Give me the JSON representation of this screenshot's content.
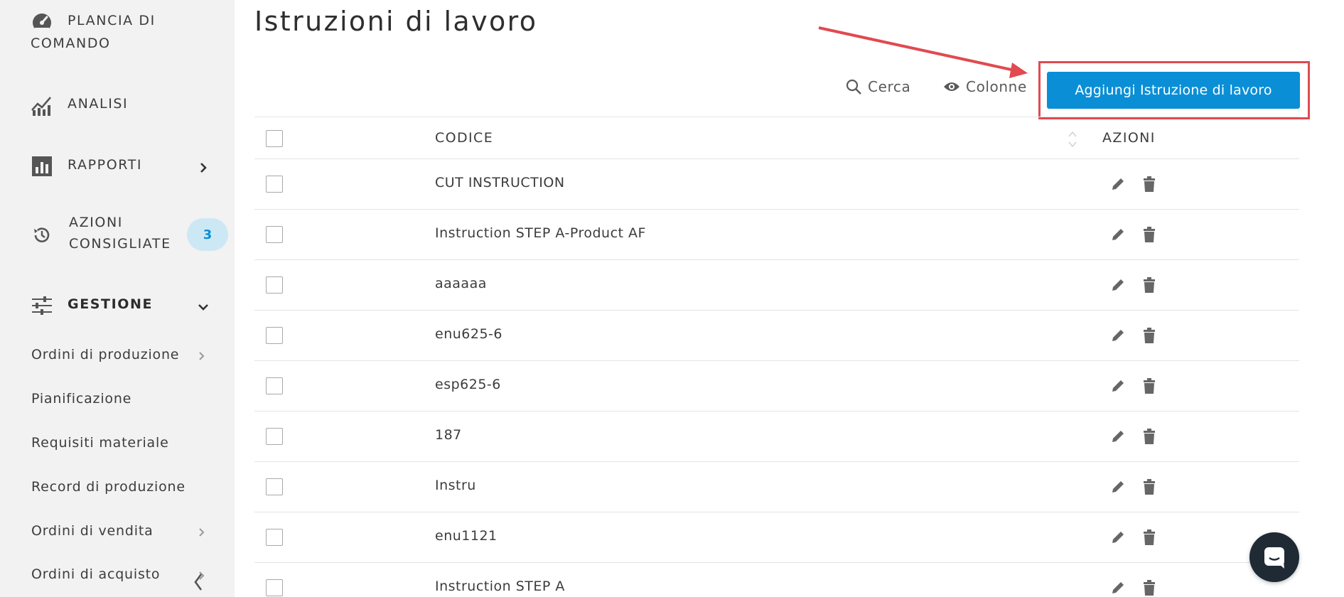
{
  "colors": {
    "accent": "#0a8fd6",
    "sidebar_bg": "#f2f2f2",
    "badge_bg": "#cde8f5",
    "highlight": "#e04a50",
    "chat_bg": "#1f2a35"
  },
  "sidebar": {
    "dashboard": {
      "label_line1": "PLANCIA DI",
      "label_line2": "COMANDO",
      "icon": "speedometer-icon"
    },
    "analytics": {
      "label": "ANALISI",
      "icon": "analytics-chart-icon"
    },
    "reports": {
      "label": "RAPPORTI",
      "icon": "bar-chart-icon"
    },
    "recommended": {
      "label_line1": "AZIONI",
      "label_line2": "CONSIGLIATE",
      "badge": "3",
      "icon": "history-icon"
    },
    "management": {
      "label": "GESTIONE",
      "icon": "sliders-icon"
    },
    "sub_items": [
      {
        "label": "Ordini di produzione",
        "has_chevron": true
      },
      {
        "label": "Pianificazione",
        "has_chevron": false
      },
      {
        "label": "Requisiti materiale",
        "has_chevron": false
      },
      {
        "label": "Record di produzione",
        "has_chevron": false
      },
      {
        "label": "Ordini di vendita",
        "has_chevron": true
      },
      {
        "label": "Ordini di acquisto",
        "has_chevron": true
      }
    ]
  },
  "page": {
    "title": "Istruzioni di lavoro"
  },
  "toolbar": {
    "search_label": "Cerca",
    "columns_label": "Colonne",
    "add_label": "Aggiungi Istruzione di lavoro"
  },
  "table": {
    "headers": {
      "code": "CODICE",
      "actions": "AZIONI"
    },
    "rows": [
      "CUT INSTRUCTION",
      "Instruction STEP A-Product AF",
      "aaaaaa",
      "enu625-6",
      "esp625-6",
      "187",
      "Instru",
      "enu1121",
      "Instruction STEP A"
    ]
  }
}
